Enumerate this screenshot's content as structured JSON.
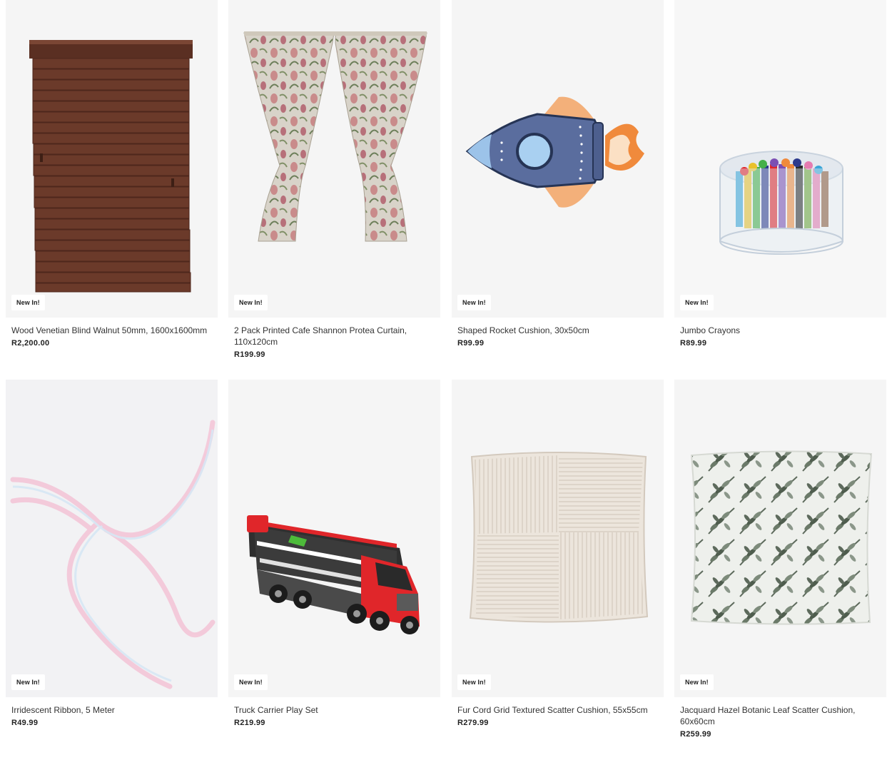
{
  "products": [
    {
      "name": "Wood Venetian Blind Walnut 50mm, 1600x1600mm",
      "price": "R2,200.00",
      "badge": "New In!",
      "image": "venetian-blind-image"
    },
    {
      "name": "2 Pack Printed Cafe Shannon Protea Curtain, 110x120cm",
      "price": "R199.99",
      "badge": "New In!",
      "image": "curtain-image"
    },
    {
      "name": "Shaped Rocket Cushion, 30x50cm",
      "price": "R99.99",
      "badge": "New In!",
      "image": "rocket-cushion-image"
    },
    {
      "name": "Jumbo Crayons",
      "price": "R89.99",
      "badge": "New In!",
      "image": "crayons-image"
    },
    {
      "name": "Irridescent Ribbon, 5 Meter",
      "price": "R49.99",
      "badge": "New In!",
      "image": "ribbon-image"
    },
    {
      "name": "Truck Carrier Play Set",
      "price": "R219.99",
      "badge": "New In!",
      "image": "truck-image"
    },
    {
      "name": "Fur Cord Grid Textured Scatter Cushion, 55x55cm",
      "price": "R279.99",
      "badge": "New In!",
      "image": "cord-cushion-image"
    },
    {
      "name": "Jacquard Hazel Botanic Leaf Scatter Cushion, 60x60cm",
      "price": "R259.99",
      "badge": "New In!",
      "image": "leaf-cushion-image"
    }
  ],
  "colors": {
    "tile_background": "#f5f5f5",
    "badge_background": "#ffffff",
    "blind": "#6b3a2a",
    "truck_red": "#e0262a"
  }
}
